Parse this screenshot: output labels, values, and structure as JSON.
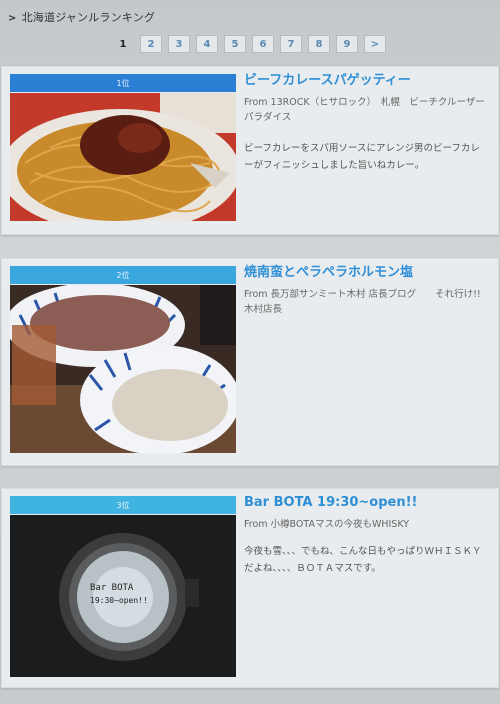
{
  "breadcrumb": {
    "caret": ">",
    "title": "北海道ジャンルランキング"
  },
  "pager": {
    "items": [
      "1",
      "2",
      "3",
      "4",
      "5",
      "6",
      "7",
      "8",
      "9",
      ">"
    ],
    "current": "1"
  },
  "entries": [
    {
      "rank": "1位",
      "title": "ビーフカレースパゲッティー",
      "from": "From 13ROCK（ヒサロック）　札幌　ビーチクルーザーパラダイス",
      "desc": "ビーフカレーをスパ用ソースにアレンジ男のビーフカレーがフィニッシュしました旨いねカレー。",
      "rank_color": "#2a7fd4"
    },
    {
      "rank": "2位",
      "title": "焼南蛮とペラペラホルモン塩",
      "from": "From 長万部サンミート木村 店長ブログ　　それ行け!! 木村店長",
      "desc": "",
      "rank_color": "#3aa6de"
    },
    {
      "rank": "3位",
      "title": "Bar BOTA 19:30~open!!",
      "from": "From 小樽BOTAマスの今夜もWHISKY",
      "desc": "今夜も雪、、、でもね、こんな日もやっぱりＷＨＩＳＫＹだよね、、、、ＢＯＴＡマスです。",
      "rank_color": "#3fb4e0",
      "photo_caption": "Bar BOTA\n19:30~open!!"
    }
  ]
}
